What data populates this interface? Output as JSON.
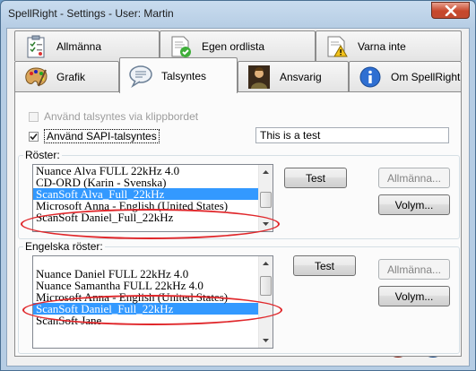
{
  "window": {
    "title": "SpellRight - Settings - User: Martin"
  },
  "tabs_row1": [
    {
      "label": "Allmänna",
      "icon": "clipboard-checklist-icon"
    },
    {
      "label": "Egen ordlista",
      "icon": "document-check-icon"
    },
    {
      "label": "Varna inte",
      "icon": "document-warning-icon"
    }
  ],
  "tabs_row2": [
    {
      "label": "Grafik",
      "icon": "paint-palette-icon"
    },
    {
      "label": "Talsyntes",
      "icon": "speech-bubble-icon",
      "active": true
    },
    {
      "label": "Ansvarig",
      "icon": "person-portrait-icon"
    },
    {
      "label": "Om SpellRight",
      "icon": "info-icon"
    }
  ],
  "options": {
    "clipboard_tts_label": "Använd talsyntes via klippbordet",
    "clipboard_tts_checked": false,
    "sapi_label": "Använd SAPI-talsyntes",
    "sapi_checked": true,
    "test_text_value": "This is a test"
  },
  "voices_group": {
    "legend": "Röster:",
    "items": [
      "Nuance Alva FULL 22kHz 4.0",
      "CD-ORD (Karin - Svenska)",
      "ScanSoft Alva_Full_22kHz",
      "Microsoft Anna - English (United States)",
      "ScanSoft Daniel_Full_22kHz"
    ],
    "selected_index": 2,
    "test_button": "Test",
    "general_button": "Allmänna...",
    "volume_button": "Volym..."
  },
  "english_group": {
    "legend": "Engelska röster:",
    "items": [
      "Nuance Daniel FULL 22kHz 4.0",
      "Nuance Samantha FULL 22kHz 4.0",
      "Microsoft Anna - English (United States)",
      "ScanSoft Daniel_Full_22kHz",
      "ScanSoft Jane"
    ],
    "selected_index": 3,
    "test_button": "Test",
    "general_button": "Allmänna...",
    "volume_button": "Volym..."
  },
  "footer": {
    "ok_icon": "checkmark-icon",
    "cancel_icon": "cancel-icon",
    "help_icon": "help-icon"
  },
  "colors": {
    "selection": "#3399ff",
    "annotation": "#e0272b",
    "ok": "#3aa935",
    "cancel": "#d23a28",
    "help": "#2a6fc4"
  }
}
